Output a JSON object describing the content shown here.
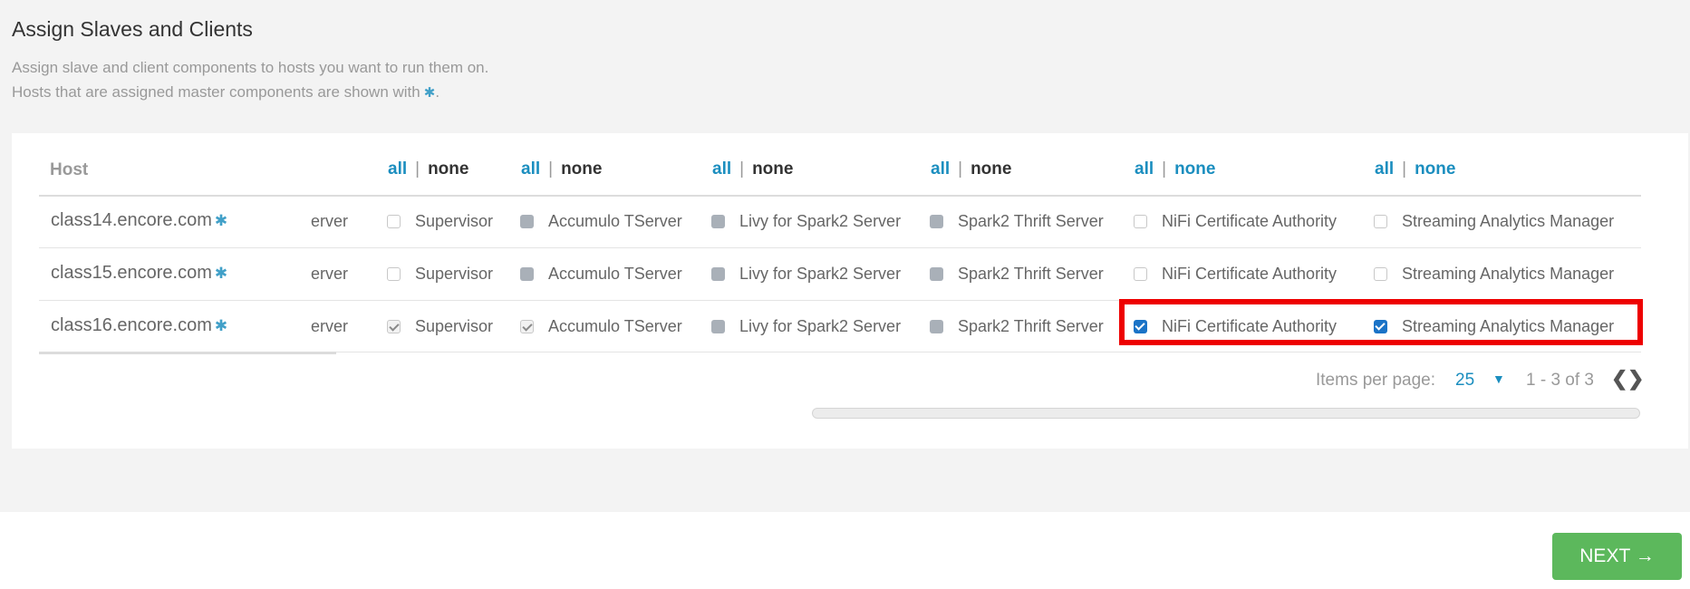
{
  "page": {
    "title": "Assign Slaves and Clients",
    "description_line1": "Assign slave and client components to hosts you want to run them on.",
    "description_line2": "Hosts that are assigned master components are shown with",
    "description_line2_end": ".",
    "master_marker": "✱"
  },
  "table": {
    "host_header": "Host",
    "column_headers": [
      {
        "all": "all",
        "sep": "|",
        "none": "none"
      },
      {
        "all": "all",
        "sep": "|",
        "none": "none"
      },
      {
        "all": "all",
        "sep": "|",
        "none": "none"
      },
      {
        "all": "all",
        "sep": "|",
        "none": "none"
      },
      {
        "all": "all",
        "sep": "|",
        "none": "none"
      },
      {
        "all": "all",
        "sep": "|",
        "none": "none"
      }
    ],
    "rows": [
      {
        "host": "class14.encore.com",
        "partial": "erver",
        "cells": [
          {
            "label": "Supervisor",
            "state": "empty"
          },
          {
            "label": "Accumulo TServer",
            "state": "disabled"
          },
          {
            "label": "Livy for Spark2 Server",
            "state": "disabled"
          },
          {
            "label": "Spark2 Thrift Server",
            "state": "disabled"
          },
          {
            "label": "NiFi Certificate Authority",
            "state": "empty"
          },
          {
            "label": "Streaming Analytics Manager",
            "state": "empty"
          }
        ]
      },
      {
        "host": "class15.encore.com",
        "partial": "erver",
        "cells": [
          {
            "label": "Supervisor",
            "state": "empty"
          },
          {
            "label": "Accumulo TServer",
            "state": "disabled"
          },
          {
            "label": "Livy for Spark2 Server",
            "state": "disabled"
          },
          {
            "label": "Spark2 Thrift Server",
            "state": "disabled"
          },
          {
            "label": "NiFi Certificate Authority",
            "state": "empty"
          },
          {
            "label": "Streaming Analytics Manager",
            "state": "empty"
          }
        ]
      },
      {
        "host": "class16.encore.com",
        "partial": "erver",
        "cells": [
          {
            "label": "Supervisor",
            "state": "checked"
          },
          {
            "label": "Accumulo TServer",
            "state": "checked"
          },
          {
            "label": "Livy for Spark2 Server",
            "state": "disabled"
          },
          {
            "label": "Spark2 Thrift Server",
            "state": "disabled"
          },
          {
            "label": "NiFi Certificate Authority",
            "state": "checked"
          },
          {
            "label": "Streaming Analytics Manager",
            "state": "checked"
          }
        ]
      }
    ]
  },
  "pagination": {
    "items_per_page_label": "Items per page:",
    "items_per_page_value": "25",
    "dropdown_caret": "▼",
    "range": "1 - 3 of 3",
    "prev_icon": "❮",
    "next_icon": "❯"
  },
  "footer": {
    "next_label": "NEXT →"
  },
  "colors": {
    "link": "#1b8ebf",
    "highlight": "#ee0000",
    "next_button": "#5cb85c",
    "checkbox_checked": "#1a73c7"
  }
}
